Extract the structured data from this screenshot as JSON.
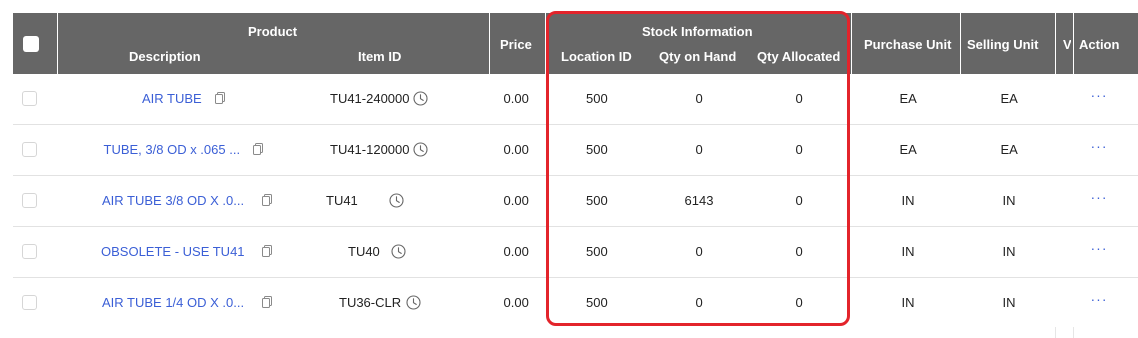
{
  "header": {
    "product_group": "Product",
    "description": "Description",
    "item_id": "Item ID",
    "price": "Price",
    "stock_group": "Stock Information",
    "location_id": "Location ID",
    "qty_on_hand": "Qty on Hand",
    "qty_allocated": "Qty Allocated",
    "purchase_unit": "Purchase Unit",
    "selling_unit": "Selling Unit",
    "truncated_col": "V",
    "action": "Action"
  },
  "rows": [
    {
      "description": "AIR TUBE",
      "item_id": "TU41-240000",
      "price": "0.00",
      "location_id": "500",
      "qty_on_hand": "0",
      "qty_allocated": "0",
      "purchase_unit": "EA",
      "selling_unit": "EA",
      "action": "···"
    },
    {
      "description": "TUBE, 3/8 OD x .065 ...",
      "item_id": "TU41-120000",
      "price": "0.00",
      "location_id": "500",
      "qty_on_hand": "0",
      "qty_allocated": "0",
      "purchase_unit": "EA",
      "selling_unit": "EA",
      "action": "···"
    },
    {
      "description": "AIR TUBE 3/8 OD X .0...",
      "item_id": "TU41",
      "price": "0.00",
      "location_id": "500",
      "qty_on_hand": "6143",
      "qty_allocated": "0",
      "purchase_unit": "IN",
      "selling_unit": "IN",
      "action": "···"
    },
    {
      "description": "OBSOLETE - USE TU41",
      "item_id": "TU40",
      "price": "0.00",
      "location_id": "500",
      "qty_on_hand": "0",
      "qty_allocated": "0",
      "purchase_unit": "IN",
      "selling_unit": "IN",
      "action": "···"
    },
    {
      "description": "AIR TUBE 1/4 OD X .0...",
      "item_id": "TU36-CLR",
      "price": "0.00",
      "location_id": "500",
      "qty_on_hand": "0",
      "qty_allocated": "0",
      "purchase_unit": "IN",
      "selling_unit": "IN",
      "action": "···"
    }
  ],
  "annotation": {
    "color": "#e3242b"
  }
}
